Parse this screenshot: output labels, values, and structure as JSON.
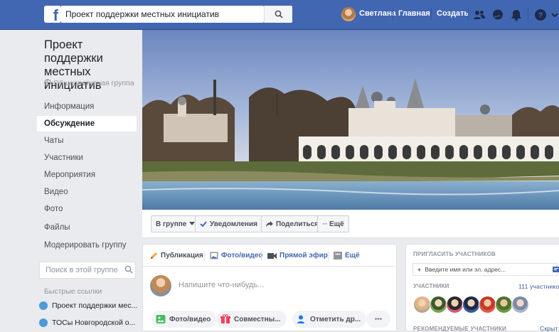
{
  "topbar": {
    "search_value": "Проект поддержки местных инициатив",
    "user_name": "Светлана",
    "home_label": "Главная",
    "create_label": "Создать"
  },
  "sidebar": {
    "group_title": "Проект поддержки местных инициатив",
    "group_type": "Общедоступная группа",
    "items": [
      {
        "label": "Информация"
      },
      {
        "label": "Обсуждение"
      },
      {
        "label": "Чаты"
      },
      {
        "label": "Участники"
      },
      {
        "label": "Мероприятия"
      },
      {
        "label": "Видео"
      },
      {
        "label": "Фото"
      },
      {
        "label": "Файлы"
      },
      {
        "label": "Модерировать группу"
      }
    ],
    "search_placeholder": "Поиск в этой группе",
    "quick_links_title": "Быстрые ссылки",
    "quick_links": [
      {
        "label": "Проект поддержки мес..."
      },
      {
        "label": "ТОСы Новгородской о..."
      }
    ]
  },
  "actions": {
    "in_group": "В группе",
    "notifications": "Уведомления",
    "share": "Поделиться",
    "more": "Ещё"
  },
  "composer": {
    "tab_post": "Публикация",
    "tab_photo": "Фото/видео",
    "tab_live": "Прямой эфир",
    "tab_more": "Ещё",
    "placeholder": "Напишите что-нибудь...",
    "btn_photo": "Фото/видео",
    "btn_together": "Совместны...",
    "btn_tag": "Отметить др...",
    "btn_more": "•••"
  },
  "right": {
    "invite_title": "ПРИГЛАСИТЬ УЧАСТНИКОВ",
    "invite_placeholder": "Введите имя или эл. адрес...",
    "members_title": "УЧАСТНИКИ",
    "members_count": "111 участнико",
    "recommended_title": "РЕКОМЕНДУЕМЫЕ УЧАСТНИКИ",
    "hide_label": "Скрыт"
  },
  "colors": {
    "brand": "#4267b2",
    "background": "#e9ebee",
    "link": "#385898"
  }
}
